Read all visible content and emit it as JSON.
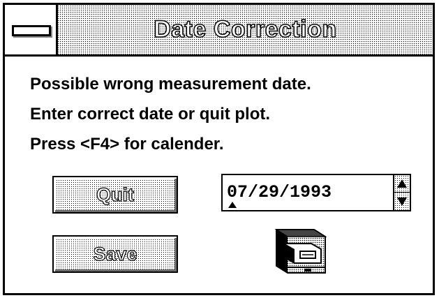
{
  "window": {
    "title": "Date Correction",
    "system_menu_icon": "system-menu-bar-icon"
  },
  "message": {
    "line1": "Possible wrong measurement date.",
    "line2": "Enter correct date or quit plot.",
    "line3": "Press <F4> for calender."
  },
  "buttons": {
    "quit_label": "Quit",
    "save_label": "Save"
  },
  "date_field": {
    "value": "07/29/1993",
    "spinner_up_icon": "arrow-up-icon",
    "spinner_down_icon": "arrow-down-icon"
  },
  "calendar": {
    "icon": "file-cabinet-icon"
  },
  "colors": {
    "foreground": "#000000",
    "background": "#ffffff",
    "dither_pattern": "50% black dots"
  }
}
